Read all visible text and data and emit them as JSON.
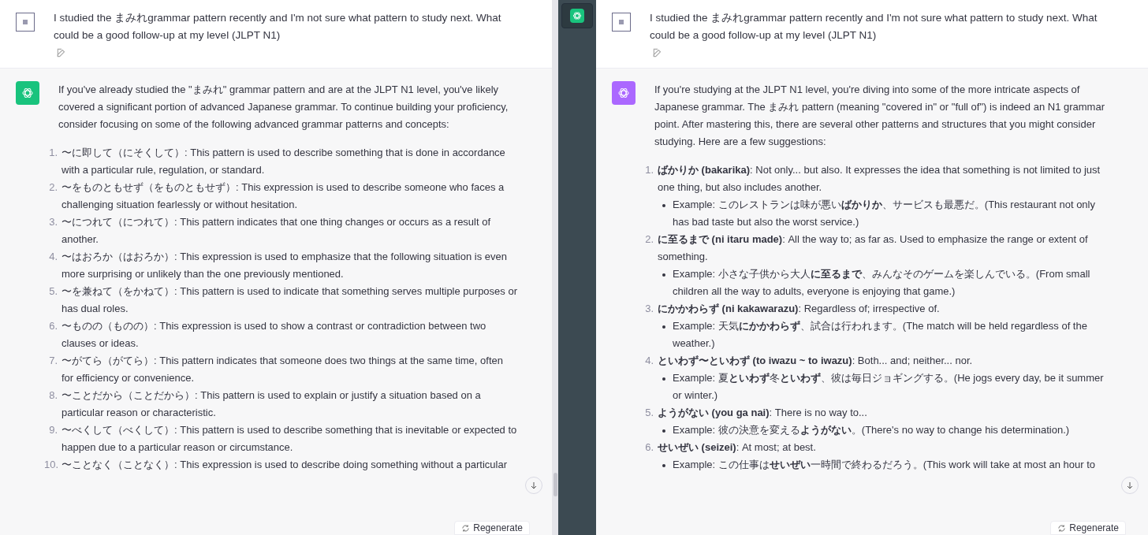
{
  "panels": [
    {
      "user_message": "I studied the まみれgrammar pattern recently and I'm not sure what pattern to study next. What could be a good follow-up at my level (JLPT N1)",
      "assistant": {
        "color": "#19c37d",
        "intro": "If you've already studied the \"まみれ\" grammar pattern and are at the JLPT N1 level, you've likely covered a significant portion of advanced Japanese grammar. To continue building your proficiency, consider focusing on some of the following advanced grammar patterns and concepts:",
        "items": [
          {
            "number": "1.",
            "text": "〜に即して（にそくして）: This pattern is used to describe something that is done in accordance with a particular rule, regulation, or standard."
          },
          {
            "number": "2.",
            "text": "〜をものともせず（をものともせず）: This expression is used to describe someone who faces a challenging situation fearlessly or without hesitation."
          },
          {
            "number": "3.",
            "text": "〜につれて（につれて）: This pattern indicates that one thing changes or occurs as a result of another."
          },
          {
            "number": "4.",
            "text": "〜はおろか（はおろか）: This expression is used to emphasize that the following situation is even more surprising or unlikely than the one previously mentioned."
          },
          {
            "number": "5.",
            "text": "〜を兼ねて（をかねて）: This pattern is used to indicate that something serves multiple purposes or has dual roles."
          },
          {
            "number": "6.",
            "text": "〜ものの（ものの）: This expression is used to show a contrast or contradiction between two clauses or ideas."
          },
          {
            "number": "7.",
            "text": "〜がてら（がてら）: This pattern indicates that someone does two things at the same time, often for efficiency or convenience."
          },
          {
            "number": "8.",
            "text": "〜ことだから（ことだから）: This pattern is used to explain or justify a situation based on a particular reason or characteristic."
          },
          {
            "number": "9.",
            "text": "〜べくして（べくして）: This pattern is used to describe something that is inevitable or expected to happen due to a particular reason or circumstance."
          },
          {
            "number": "10.",
            "text": "〜ことなく（ことなく）: This expression is used to describe doing something without a particular"
          }
        ]
      },
      "regenerate": "Regenerate"
    },
    {
      "user_message": "I studied the まみれgrammar pattern recently and I'm not sure what pattern to study next. What could be a good follow-up at my level (JLPT N1)",
      "assistant": {
        "color": "#ab68ff",
        "intro": "If you're studying at the JLPT N1 level, you're diving into some of the more intricate aspects of Japanese grammar. The まみれ pattern (meaning \"covered in\" or \"full of\") is indeed an N1 grammar point. After mastering this, there are several other patterns and structures that you might consider studying. Here are a few suggestions:",
        "items": [
          {
            "number": "1.",
            "text": "**ばかりか (bakarika)**: Not only... but also. It expresses the idea that something is not limited to just one thing, but also includes another.",
            "examples": [
              "Example: このレストランは味が悪い**ばかりか**、サービスも最悪だ。(This restaurant not only has bad taste but also the worst service.)"
            ]
          },
          {
            "number": "2.",
            "text": "**に至るまで (ni itaru made)**: All the way to; as far as. Used to emphasize the range or extent of something.",
            "examples": [
              "Example: 小さな子供から大人**に至るまで**、みんなそのゲームを楽しんでいる。(From small children all the way to adults, everyone is enjoying that game.)"
            ]
          },
          {
            "number": "3.",
            "text": "**にかかわらず (ni kakawarazu)**: Regardless of; irrespective of.",
            "examples": [
              "Example: 天気**にかかわらず**、試合は行われます。(The match will be held regardless of the weather.)"
            ]
          },
          {
            "number": "4.",
            "text": "**といわず〜といわず (to iwazu ~ to iwazu)**: Both... and; neither... nor.",
            "examples": [
              "Example: 夏**といわず**冬**といわず**、彼は毎日ジョギングする。(He jogs every day, be it summer or winter.)"
            ]
          },
          {
            "number": "5.",
            "text": "**ようがない (you ga nai)**: There is no way to...",
            "examples": [
              "Example: 彼の決意を変える**ようがない**。(There's no way to change his determination.)"
            ]
          },
          {
            "number": "6.",
            "text": "**せいぜい (seizei)**: At most; at best.",
            "examples": [
              "Example: この仕事は**せいぜい**一時間で終わるだろう。(This work will take at most an hour to"
            ]
          }
        ]
      },
      "regenerate": "Regenerate"
    }
  ]
}
